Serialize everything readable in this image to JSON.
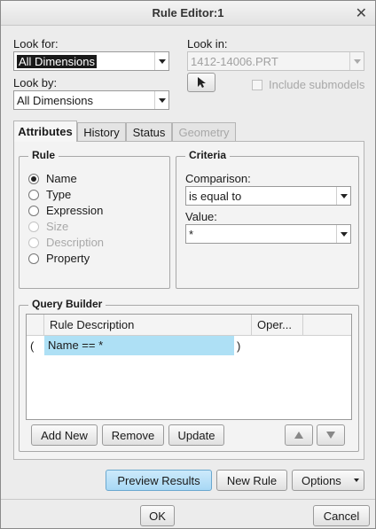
{
  "window": {
    "title": "Rule Editor:1"
  },
  "look_for": {
    "label": "Look for:",
    "value": "All Dimensions"
  },
  "look_by": {
    "label": "Look by:",
    "value": "All Dimensions"
  },
  "look_in": {
    "label": "Look in:",
    "value": "1412-14006.PRT",
    "include_submodels": "Include submodels"
  },
  "tabs": [
    {
      "label": "Attributes"
    },
    {
      "label": "History"
    },
    {
      "label": "Status"
    },
    {
      "label": "Geometry"
    }
  ],
  "rule": {
    "title": "Rule",
    "options": [
      "Name",
      "Type",
      "Expression",
      "Size",
      "Description",
      "Property"
    ],
    "selected": "Name"
  },
  "criteria": {
    "title": "Criteria",
    "comparison_label": "Comparison:",
    "comparison_value": "is equal to",
    "value_label": "Value:",
    "value": "*"
  },
  "query_builder": {
    "title": "Query Builder",
    "columns": [
      "Rule Description",
      "Oper..."
    ],
    "row": {
      "open_paren": "(",
      "description": "Name == *",
      "close_paren": ")"
    },
    "buttons": {
      "add_new": "Add New",
      "remove": "Remove",
      "update": "Update"
    }
  },
  "actions": {
    "preview": "Preview Results",
    "new_rule": "New Rule",
    "options": "Options"
  },
  "footer": {
    "ok": "OK",
    "cancel": "Cancel"
  }
}
